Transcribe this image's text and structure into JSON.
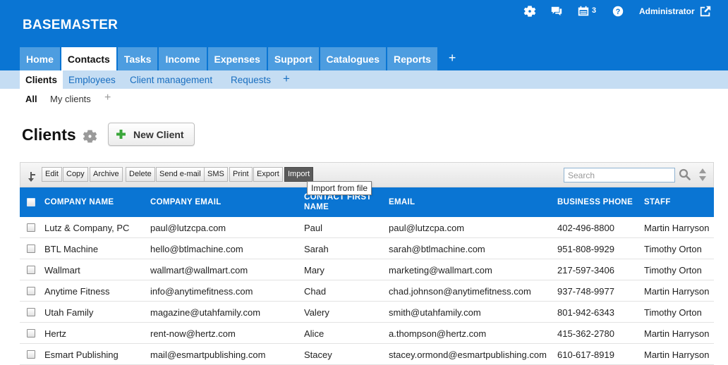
{
  "app": {
    "brand": "BASEMASTER"
  },
  "header": {
    "tasks_count": "3",
    "user": "Administrator"
  },
  "main_tabs": [
    {
      "label": "Home",
      "active": false
    },
    {
      "label": "Contacts",
      "active": true
    },
    {
      "label": "Tasks",
      "active": false
    },
    {
      "label": "Income",
      "active": false
    },
    {
      "label": "Expenses",
      "active": false
    },
    {
      "label": "Support",
      "active": false
    },
    {
      "label": "Catalogues",
      "active": false
    },
    {
      "label": "Reports",
      "active": false
    }
  ],
  "sub_tabs": [
    {
      "label": "Clients",
      "active": true
    },
    {
      "label": "Employees",
      "active": false
    },
    {
      "label": "Client management",
      "active": false
    },
    {
      "label": "Requests",
      "active": false
    }
  ],
  "filters": {
    "all": "All",
    "mine": "My clients",
    "add": "+"
  },
  "page": {
    "title": "Clients",
    "new_button": "New Client"
  },
  "toolbar": {
    "buttons": [
      "Edit",
      "Copy",
      "Archive",
      "Delete",
      "Send e-mail",
      "SMS",
      "Print",
      "Export",
      "Import"
    ],
    "search_placeholder": "Search",
    "tooltip": "Import from file"
  },
  "table": {
    "columns": [
      "COMPANY NAME",
      "COMPANY EMAIL",
      "CONTACT FIRST NAME",
      "EMAIL",
      "BUSINESS PHONE",
      "STAFF"
    ],
    "rows": [
      [
        "Lutz & Company, PC",
        "paul@lutzcpa.com",
        "Paul",
        "paul@lutzcpa.com",
        "402-496-8800",
        "Martin Harryson"
      ],
      [
        "BTL Machine",
        "hello@btlmachine.com",
        "Sarah",
        "sarah@btlmachine.com",
        "951-808-9929",
        "Timothy Orton"
      ],
      [
        "Wallmart",
        "wallmart@wallmart.com",
        "Mary",
        "marketing@wallmart.com",
        "217-597-3406",
        "Timothy Orton"
      ],
      [
        "Anytime Fitness",
        "info@anytimefitness.com",
        "Chad",
        "chad.johnson@anytimefitness.com",
        "937-748-9977",
        "Martin Harryson"
      ],
      [
        "Utah Family",
        "magazine@utahfamily.com",
        "Valery",
        "smith@utahfamily.com",
        "801-942-6343",
        "Timothy Orton"
      ],
      [
        "Hertz",
        "rent-now@hertz.com",
        "Alice",
        "a.thompson@hertz.com",
        "415-362-2780",
        "Martin Harryson"
      ],
      [
        "Esmart Publishing",
        "mail@esmartpublishing.com",
        "Stacey",
        "stacey.ormond@esmartpublishing.com",
        "610-617-8919",
        "Martin Harryson"
      ]
    ]
  },
  "colors": {
    "primary": "#0a75d3",
    "tab": "#4d9de0",
    "subnav": "#c5ddf3",
    "link": "#1a6fc0"
  }
}
